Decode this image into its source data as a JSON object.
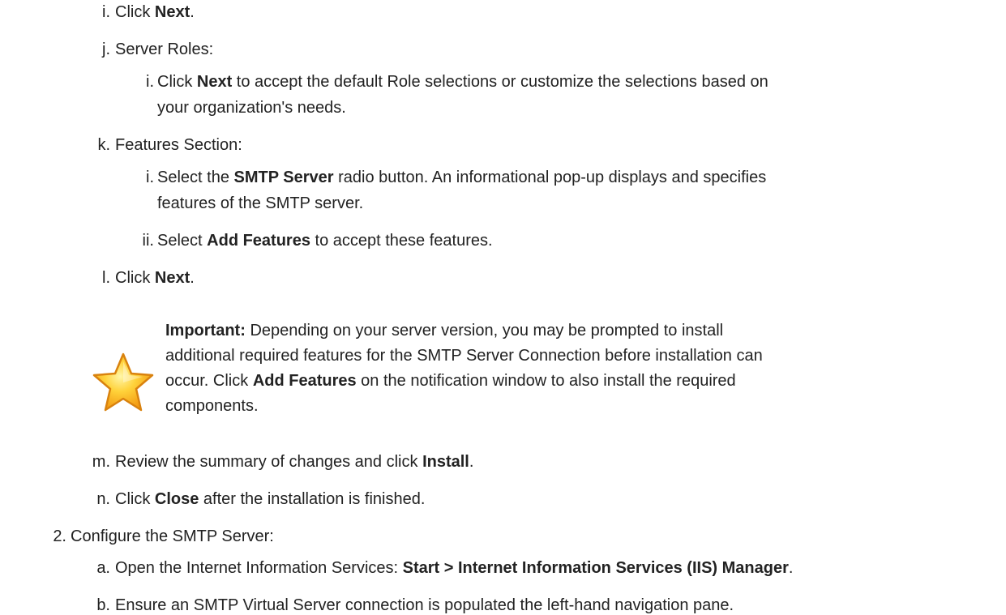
{
  "steps": {
    "i_top": {
      "marker": "i.",
      "pre": "Click ",
      "bold": "Next",
      "post": "."
    },
    "j": {
      "marker": "j.",
      "text": "Server Roles:",
      "sub_i": {
        "marker": "i.",
        "pre": "Click ",
        "bold": "Next",
        "line1_post": " to accept the default Role selections or customize the selections based on",
        "line2": "your organization's needs."
      }
    },
    "k": {
      "marker": "k.",
      "text": "Features Section:",
      "sub_i": {
        "marker": "i.",
        "pre": "Select the ",
        "bold": "SMTP Server",
        "line1_post": " radio button. An informational pop-up displays and specifies",
        "line2": "features of the SMTP server."
      },
      "sub_ii": {
        "marker": "ii.",
        "pre": "Select ",
        "bold": "Add Features",
        "post": " to accept these features."
      }
    },
    "l": {
      "marker": "l.",
      "pre": "Click ",
      "bold": "Next",
      "post": "."
    },
    "note": {
      "icon": "star-icon",
      "label": "Important:",
      "line1_post": " Depending on your server version, you may be prompted to install",
      "line2": "additional required features for the SMTP Server Connection before installation can",
      "line3_pre": "occur. Click ",
      "line3_bold": "Add Features",
      "line3_post": " on the notification window to also install the required",
      "line4": "components."
    },
    "m": {
      "marker": "m.",
      "pre": "Review the summary of changes and click ",
      "bold": "Install",
      "post": "."
    },
    "n": {
      "marker": "n.",
      "pre": "Click ",
      "bold": "Close",
      "post": " after the installation is finished."
    },
    "two": {
      "marker": "2.",
      "text": "Configure the SMTP Server:",
      "a": {
        "marker": "a.",
        "pre": "Open the Internet Information Services: ",
        "bold": "Start > Internet Information Services (IIS) Manager",
        "post": "."
      },
      "b": {
        "marker": "b.",
        "text": "Ensure an SMTP Virtual Server connection is populated the left-hand navigation pane."
      }
    }
  }
}
